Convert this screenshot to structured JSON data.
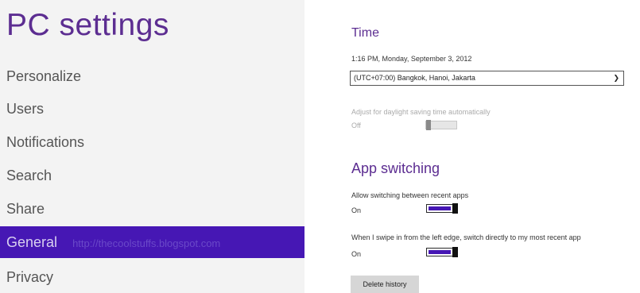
{
  "sidebar": {
    "title": "PC settings",
    "items": [
      {
        "label": "Personalize"
      },
      {
        "label": "Users"
      },
      {
        "label": "Notifications"
      },
      {
        "label": "Search"
      },
      {
        "label": "Share"
      },
      {
        "label": "General",
        "watermark": "http://thecoolstuffs.blogspot.com"
      },
      {
        "label": "Privacy"
      }
    ],
    "selected": "General"
  },
  "time": {
    "heading": "Time",
    "current": "1:16 PM, Monday, September 3, 2012",
    "timezone_value": "(UTC+07:00) Bangkok, Hanoi, Jakarta",
    "dst_label": "Adjust for daylight saving time automatically",
    "dst_state": "Off"
  },
  "app_switching": {
    "heading": "App switching",
    "recent_label": "Allow switching between recent apps",
    "recent_state": "On",
    "swipe_label": "When I swipe in from the left edge, switch directly to my most recent app",
    "swipe_state": "On",
    "delete_button": "Delete history"
  },
  "colors": {
    "accent": "#4617b4",
    "title": "#5c2d91",
    "sidebar_bg": "#f3f3f3"
  }
}
